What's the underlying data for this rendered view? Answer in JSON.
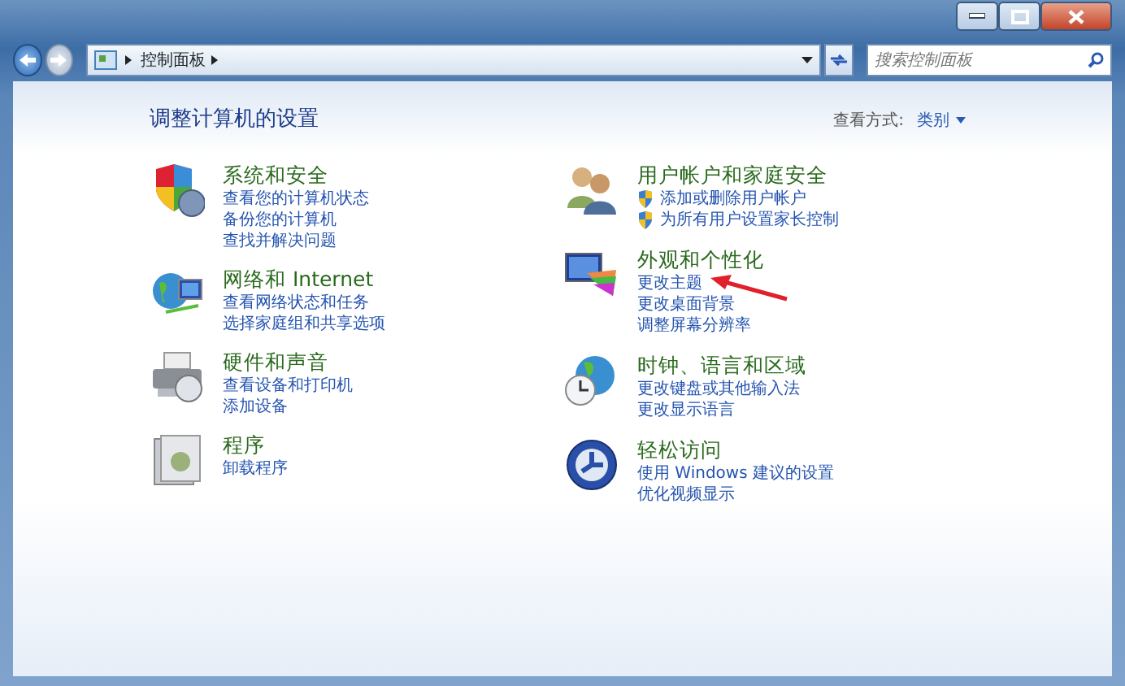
{
  "address_bar": {
    "crumbs": [
      "控制面板"
    ]
  },
  "search": {
    "placeholder": "搜索控制面板"
  },
  "heading": "调整计算机的设置",
  "view_by": {
    "label": "查看方式:",
    "value": "类别"
  },
  "columns": [
    [
      {
        "kind": "security",
        "title": "系统和安全",
        "links": [
          {
            "text": "查看您的计算机状态",
            "shield": false
          },
          {
            "text": "备份您的计算机",
            "shield": false
          },
          {
            "text": "查找并解决问题",
            "shield": false
          }
        ]
      },
      {
        "kind": "network",
        "title": "网络和 Internet",
        "links": [
          {
            "text": "查看网络状态和任务",
            "shield": false
          },
          {
            "text": "选择家庭组和共享选项",
            "shield": false
          }
        ]
      },
      {
        "kind": "hardware",
        "title": "硬件和声音",
        "links": [
          {
            "text": "查看设备和打印机",
            "shield": false
          },
          {
            "text": "添加设备",
            "shield": false
          }
        ]
      },
      {
        "kind": "programs",
        "title": "程序",
        "links": [
          {
            "text": "卸载程序",
            "shield": false
          }
        ]
      }
    ],
    [
      {
        "kind": "users",
        "title": "用户帐户和家庭安全",
        "links": [
          {
            "text": "添加或删除用户帐户",
            "shield": true
          },
          {
            "text": "为所有用户设置家长控制",
            "shield": true
          }
        ]
      },
      {
        "kind": "appearance",
        "title": "外观和个性化",
        "links": [
          {
            "text": "更改主题",
            "shield": false
          },
          {
            "text": "更改桌面背景",
            "shield": false
          },
          {
            "text": "调整屏幕分辨率",
            "shield": false
          }
        ]
      },
      {
        "kind": "clock",
        "title": "时钟、语言和区域",
        "links": [
          {
            "text": "更改键盘或其他输入法",
            "shield": false
          },
          {
            "text": "更改显示语言",
            "shield": false
          }
        ]
      },
      {
        "kind": "access",
        "title": "轻松访问",
        "links": [
          {
            "text": "使用 Windows 建议的设置",
            "shield": false
          },
          {
            "text": "优化视频显示",
            "shield": false
          }
        ]
      }
    ]
  ]
}
